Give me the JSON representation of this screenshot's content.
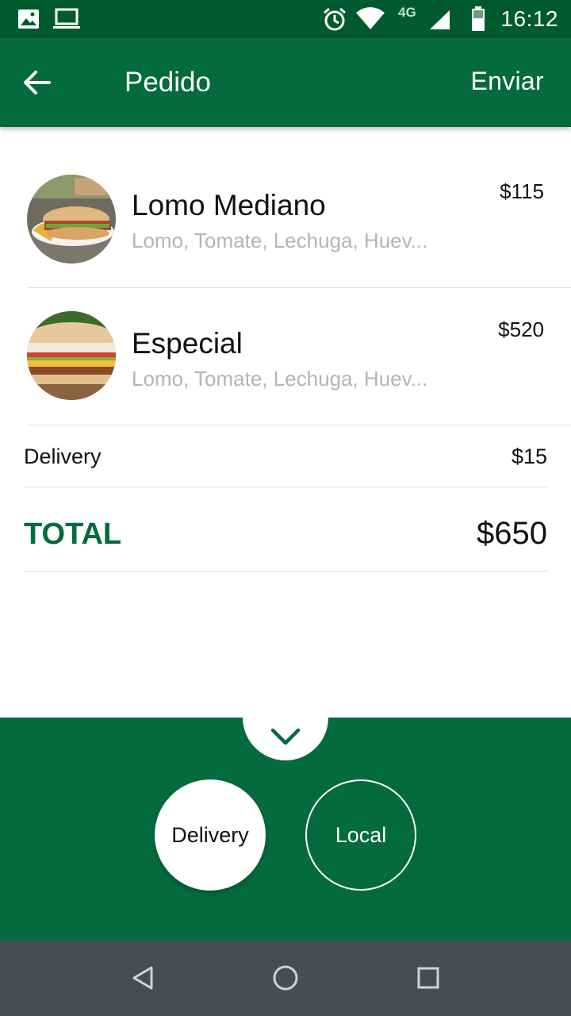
{
  "status_bar": {
    "time": "16:12",
    "network": "4G",
    "icons": [
      "image-icon",
      "laptop-icon",
      "alarm-icon",
      "wifi-icon",
      "signal-icon",
      "battery-icon"
    ]
  },
  "app_bar": {
    "title": "Pedido",
    "send_label": "Enviar",
    "back_icon": "arrow-left-icon"
  },
  "items": [
    {
      "name": "Lomo Mediano",
      "description": "Lomo, Tomate, Lechuga, Huev...",
      "price": "$115"
    },
    {
      "name": "Especial",
      "description": "Lomo, Tomate, Lechuga, Huev...",
      "price": "$520"
    }
  ],
  "delivery": {
    "label": "Delivery",
    "price": "$15"
  },
  "total": {
    "label": "TOTAL",
    "value": "$650"
  },
  "options": {
    "toggle_icon": "chevron-down-icon",
    "delivery_label": "Delivery",
    "local_label": "Local",
    "selected": "Delivery"
  },
  "nav": {
    "icons": [
      "back-triangle-icon",
      "home-circle-icon",
      "recents-square-icon"
    ]
  },
  "colors": {
    "status_bar": "#005a30",
    "primary": "#036b3e",
    "nav_bar": "#484d52"
  }
}
